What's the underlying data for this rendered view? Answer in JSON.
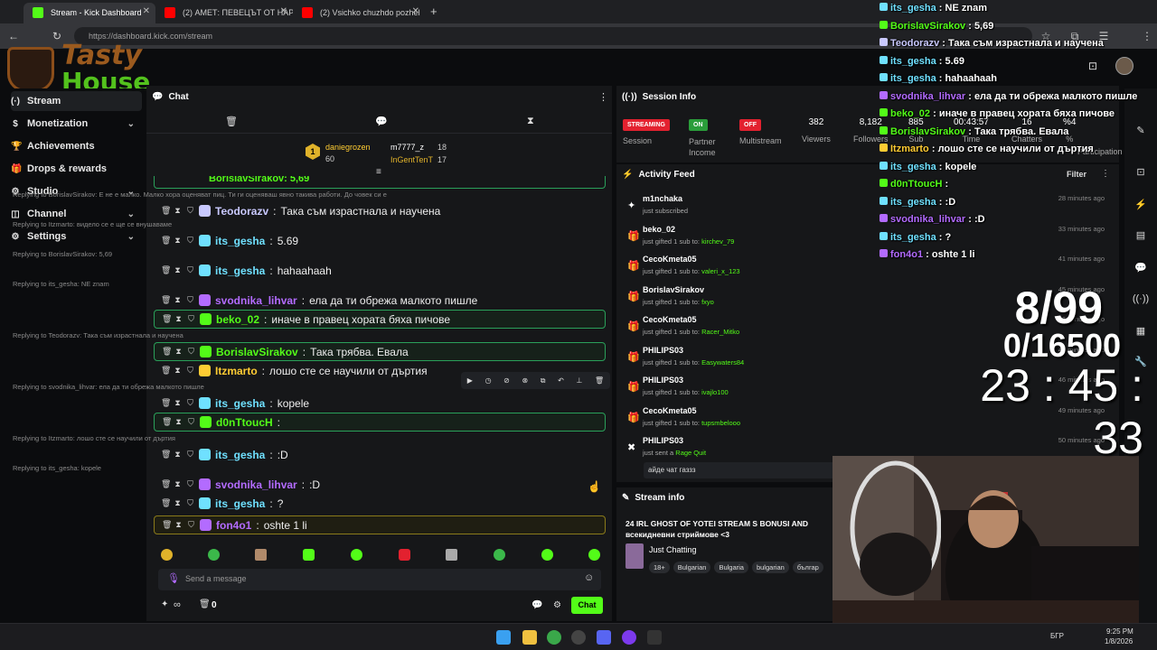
{
  "browser": {
    "tabs": [
      {
        "title": "Stream - Kick Dashboard",
        "color": "#53fc18"
      },
      {
        "title": "(2) АМЕТ: ПЕВЕЦЪТ ОТ НАРОД",
        "color": "#ff0000"
      },
      {
        "title": "(2) Vsichko chuzhdo pozhel",
        "color": "#ff0000"
      }
    ],
    "url": "https://dashboard.kick.com/stream",
    "new_tab": "+"
  },
  "logo": {
    "line1": "Tasty",
    "line2": "House"
  },
  "sidebar": {
    "items": [
      {
        "label": "Stream",
        "icon": "(·)",
        "chev": ""
      },
      {
        "label": "Monetization",
        "icon": "$",
        "chev": "⌄"
      },
      {
        "label": "Achievements",
        "icon": "🏆",
        "chev": ""
      },
      {
        "label": "Drops & rewards",
        "icon": "🎁",
        "chev": ""
      },
      {
        "label": "Studio",
        "icon": "⚙",
        "chev": "⌄"
      },
      {
        "label": "Channel",
        "icon": "◫",
        "chev": "⌄"
      },
      {
        "label": "Settings",
        "icon": "⚙",
        "chev": "⌄"
      }
    ]
  },
  "chat": {
    "title": "Chat",
    "leaderboard": [
      {
        "rank": "1",
        "name": "daniegrozen",
        "value": "60"
      },
      {
        "rank": "",
        "name": "m7777_z",
        "value": "18"
      },
      {
        "rank": "",
        "name": "InGentTenT",
        "value": "17"
      }
    ],
    "top_partial": "BorislavSirakov: 5,69",
    "messages": [
      {
        "reply": "Replying to BorislavSirakov: Е не е малко. Малко хора оценяват пиц. Ти ги оценяваш явно такива работи. До човек си е",
        "user": "Teodorazv",
        "color": "#c9c9ff",
        "text": "Така съм израстнала и научена",
        "style": ""
      },
      {
        "reply": "Replying to Itzmarto: видело се е ще се внушаваме",
        "user": "its_gesha",
        "color": "#6fe0ff",
        "text": "5.69",
        "style": ""
      },
      {
        "reply": "Replying to BorislavSirakov: 5,69",
        "user": "its_gesha",
        "color": "#6fe0ff",
        "text": "hahaahaah",
        "style": ""
      },
      {
        "reply": "Replying to its_gesha: NE znam",
        "user": "svodnika_lihvar",
        "color": "#b36bff",
        "text": "ела да ти обрежа малкото пишле",
        "style": ""
      },
      {
        "reply": "",
        "user": "beko_02",
        "color": "#53fc18",
        "text": "иначе в правец хората бяха пичове",
        "style": "hl"
      },
      {
        "reply": "Replying to Teodorazv: Така съм израстнала и научена",
        "user": "BorislavSirakov",
        "color": "#53fc18",
        "text": "Така трябва. Евала",
        "style": "hl"
      },
      {
        "reply": "",
        "user": "Itzmarto",
        "color": "#ffcc33",
        "text": "лошо сте се научили от дъртия",
        "style": ""
      },
      {
        "reply": "Replying to svodnika_lihvar: ела да ти обрежа малкото пишле",
        "user": "its_gesha",
        "color": "#6fe0ff",
        "text": "kopele",
        "style": ""
      },
      {
        "reply": "",
        "user": "d0nTtoucH",
        "color": "#53fc18",
        "text": "",
        "style": "hl"
      },
      {
        "reply": "Replying to Itzmarto: лошо сте се научили от дъртия",
        "user": "its_gesha",
        "color": "#6fe0ff",
        "text": ":D",
        "style": ""
      },
      {
        "reply": "Replying to its_gesha: kopele",
        "user": "svodnika_lihvar",
        "color": "#b36bff",
        "text": ":D",
        "style": ""
      },
      {
        "reply": "",
        "user": "its_gesha",
        "color": "#6fe0ff",
        "text": "?",
        "style": ""
      },
      {
        "reply": "",
        "user": "fon4o1",
        "color": "#b36bff",
        "text": "oshte 1 li",
        "style": "gold"
      }
    ],
    "input_placeholder": "Send a message",
    "points_label": "∞",
    "count": "0",
    "send_label": "Chat"
  },
  "session": {
    "title": "Session Info",
    "items": [
      {
        "pill": "STREAMING",
        "pill_color": "#e3212f",
        "label": "Session"
      },
      {
        "pill": "ON",
        "pill_color": "#2a9d3a",
        "label": "Partner Income"
      },
      {
        "pill": "OFF",
        "pill_color": "#e3212f",
        "label": "Multistream"
      }
    ],
    "stats": [
      {
        "value": "382",
        "label": "Viewers"
      },
      {
        "value": "8,182",
        "label": "Followers"
      },
      {
        "value": "885",
        "label": "Sub"
      },
      {
        "value": "00:43:57",
        "label": "Time"
      },
      {
        "value": "16",
        "label": "Chatters"
      },
      {
        "value": "%4",
        "label": "%"
      },
      {
        "value": "",
        "label": "Participation"
      }
    ]
  },
  "activity": {
    "title": "Activity Feed",
    "filter": "Filter",
    "items": [
      {
        "name": "m1nchaka",
        "desc": "just subscribed",
        "target": "",
        "time": "28 minutes ago",
        "icon": "✦"
      },
      {
        "name": "beko_02",
        "desc": "just gifted 1 sub to:",
        "target": "kirchev_79",
        "time": "33 minutes ago",
        "icon": "🎁"
      },
      {
        "name": "CecoKmeta05",
        "desc": "just gifted 1 sub to:",
        "target": "valeri_x_123",
        "time": "41 minutes ago",
        "icon": "🎁"
      },
      {
        "name": "BorislavSirakov",
        "desc": "just gifted 1 sub to:",
        "target": "fxyo",
        "time": "45 minutes ago",
        "icon": "🎁"
      },
      {
        "name": "CecoKmeta05",
        "desc": "just gifted 1 sub to:",
        "target": "Racer_Mitko",
        "time": "46 minutes ago",
        "icon": "🎁"
      },
      {
        "name": "PHILIPS03",
        "desc": "just gifted 1 sub to:",
        "target": "Easywaters84",
        "time": "46 minutes ago",
        "icon": "🎁"
      },
      {
        "name": "PHILIPS03",
        "desc": "just gifted 1 sub to:",
        "target": "ivajlo100",
        "time": "46 minutes ago",
        "icon": "🎁"
      },
      {
        "name": "CecoKmeta05",
        "desc": "just gifted 1 sub to:",
        "target": "tupsmbelooo",
        "time": "49 minutes ago",
        "icon": "🎁"
      },
      {
        "name": "PHILIPS03",
        "desc": "just sent a",
        "target": "Rage Quit",
        "time": "50 minutes ago",
        "icon": "✖"
      }
    ],
    "note": "айде чат газзз"
  },
  "stream_info": {
    "title": "Stream info",
    "stream_title": "24 IRL GHOST OF YOTEI STREAM S BONUSI AND всекидневни стриймове <3",
    "category": "Just Chatting",
    "tags": [
      "18+",
      "Bulgarian",
      "Bulgaria",
      "bulgarian",
      "българ"
    ]
  },
  "overlay": {
    "chat": [
      {
        "user": "its_gesha",
        "text": "NE znam",
        "color": "#6fe0ff"
      },
      {
        "user": "BorislavSirakov",
        "text": "5,69",
        "color": "#53fc18"
      },
      {
        "user": "Teodorazv",
        "text": "Така съм израстнала и научена",
        "color": "#c9c9ff"
      },
      {
        "user": "its_gesha",
        "text": "5.69",
        "color": "#6fe0ff"
      },
      {
        "user": "its_gesha",
        "text": "hahaahaah",
        "color": "#6fe0ff"
      },
      {
        "user": "svodnika_lihvar",
        "text": "ела да ти обрежа малкото пишле",
        "color": "#b36bff"
      },
      {
        "user": "beko_02",
        "text": "иначе в правец хората бяха пичове",
        "color": "#53fc18"
      },
      {
        "user": "BorislavSirakov",
        "text": "Така трябва. Евала",
        "color": "#53fc18"
      },
      {
        "user": "Itzmarto",
        "text": "лошо сте се научили от дъртия",
        "color": "#ffcc33"
      },
      {
        "user": "its_gesha",
        "text": "kopele",
        "color": "#6fe0ff"
      },
      {
        "user": "d0nTtoucH",
        "text": "",
        "color": "#53fc18"
      },
      {
        "user": "its_gesha",
        "text": ":D",
        "color": "#6fe0ff"
      },
      {
        "user": "svodnika_lihvar",
        "text": ":D",
        "color": "#b36bff"
      },
      {
        "user": "its_gesha",
        "text": "?",
        "color": "#6fe0ff"
      },
      {
        "user": "fon4o1",
        "text": "oshte 1 li",
        "color": "#b36bff"
      }
    ],
    "goal1": "8/99",
    "goal2": "0/16500",
    "timer": "23 : 45 : 33"
  },
  "taskbar": {
    "lang": "БГР",
    "time": "9:25 PM",
    "date": "1/8/2026"
  }
}
